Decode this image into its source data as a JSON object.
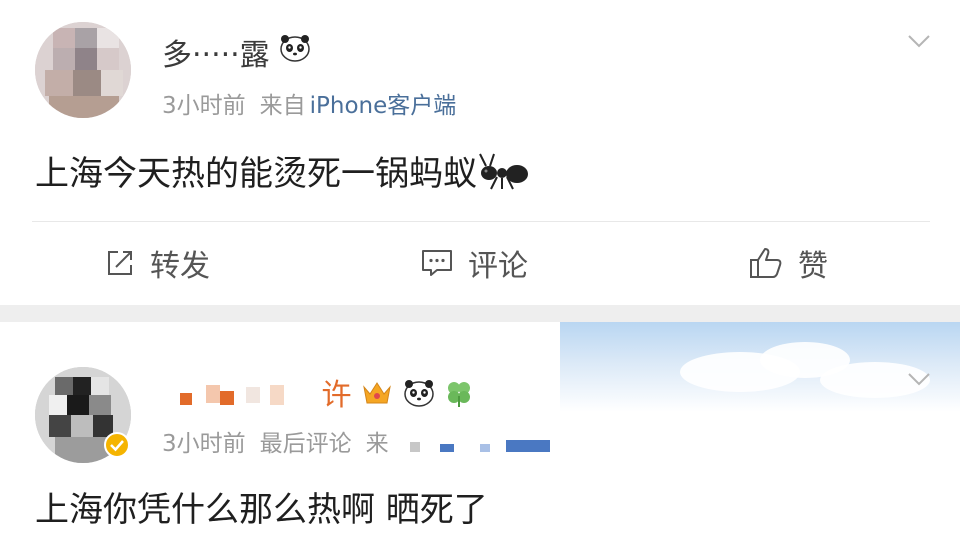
{
  "posts": [
    {
      "username": "多‧‧‧‧‧露",
      "time": "3小时前",
      "source_prefix": "来自",
      "source": "iPhone客户端",
      "content": "上海今天热的能烫死一锅蚂蚁",
      "emoji": "ant-icon"
    },
    {
      "username": "许",
      "time": "3小时前",
      "extra": "最后评论",
      "source_prefix": "来",
      "content": "上海你凭什么那么热啊 晒死了",
      "verified": true
    }
  ],
  "actions": {
    "repost_label": "转发",
    "comment_label": "评论",
    "like_label": "赞"
  },
  "colors": {
    "link": "#4a6f9a",
    "meta": "#9a9a9a",
    "separator": "#eeeeee",
    "verified": "#f5b400"
  }
}
